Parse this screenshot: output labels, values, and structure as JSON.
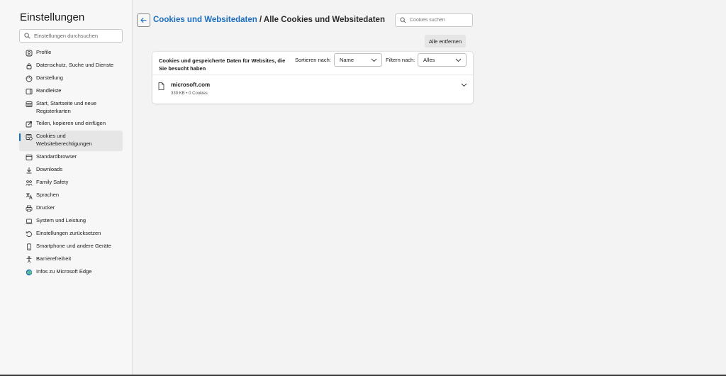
{
  "sidebar": {
    "title": "Einstellungen",
    "search_placeholder": "Einstellungen durchsuchen",
    "items": [
      {
        "label": "Profile",
        "icon": "profile-icon"
      },
      {
        "label": "Datenschutz, Suche und Dienste",
        "icon": "lock-icon"
      },
      {
        "label": "Darstellung",
        "icon": "appearance-icon"
      },
      {
        "label": "Randleiste",
        "icon": "sidebar-icon"
      },
      {
        "label": "Start, Startseite und neue Registerkarten",
        "icon": "home-tab-icon"
      },
      {
        "label": "Teilen, kopieren und einfügen",
        "icon": "share-icon"
      },
      {
        "label": "Cookies und Websiteberechtigungen",
        "icon": "cookie-permissions-icon",
        "active": true
      },
      {
        "label": "Standardbrowser",
        "icon": "browser-icon"
      },
      {
        "label": "Downloads",
        "icon": "download-icon"
      },
      {
        "label": "Family Safety",
        "icon": "family-icon"
      },
      {
        "label": "Sprachen",
        "icon": "language-icon"
      },
      {
        "label": "Drucker",
        "icon": "printer-icon"
      },
      {
        "label": "System und Leistung",
        "icon": "laptop-icon"
      },
      {
        "label": "Einstellungen zurücksetzen",
        "icon": "reset-icon"
      },
      {
        "label": "Smartphone und andere Geräte",
        "icon": "phone-icon"
      },
      {
        "label": "Barrierefreiheit",
        "icon": "accessibility-icon"
      },
      {
        "label": "Infos zu Microsoft Edge",
        "icon": "edge-logo-icon"
      }
    ]
  },
  "header": {
    "breadcrumb_link": "Cookies und Websitedaten",
    "breadcrumb_current": " / Alle Cookies und Websitedaten",
    "search_placeholder": "Cookies suchen",
    "remove_all_label": "Alle entfernen"
  },
  "card": {
    "description": "Cookies und gespeicherte Daten für Websites, die Sie besucht haben",
    "sort_label": "Sortieren nach:",
    "sort_value": "Name",
    "filter_label": "Filtern nach:",
    "filter_value": "Alles"
  },
  "sites": [
    {
      "name": "microsoft.com",
      "meta": "339 KB • 0 Cookies"
    }
  ],
  "colors": {
    "accent": "#0f6cbd",
    "link": "#1b6ec2",
    "background": "#f3f3f3",
    "card": "#ffffff"
  }
}
